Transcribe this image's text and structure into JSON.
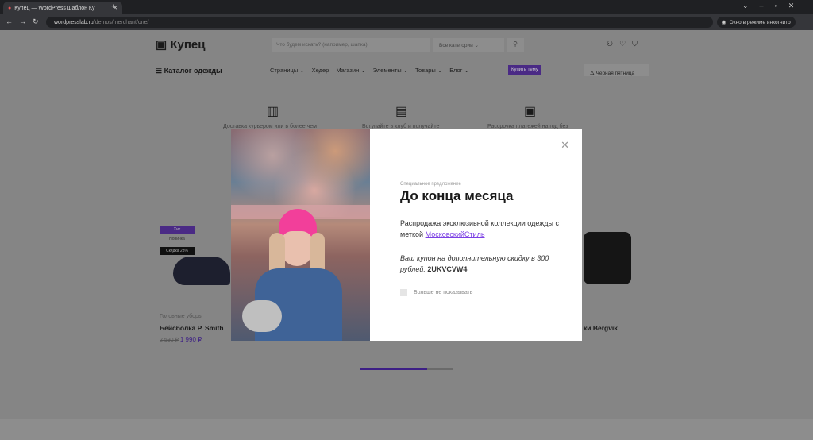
{
  "browser": {
    "tab_title": "Купец — WordPress шаблон Ку",
    "url_host": "wordpresslab.ru",
    "url_path": "/demos/merchant/one/",
    "profile": "Окно в режиме инкогнито"
  },
  "header": {
    "logo": "Купец",
    "search_placeholder": "Что будем искать? (например, шапка)",
    "category": "Все категории"
  },
  "nav": {
    "catalog": "Каталог одежды",
    "items": [
      "Страницы",
      "Хедер",
      "Магазин",
      "Элементы",
      "Товары",
      "Блог"
    ],
    "buy": "Купить тему",
    "promo": "Черная пятница"
  },
  "features": [
    "Доставка курьером или в более чем",
    "Вступайте в клуб и получайте",
    "Рассрочка платежей на год без"
  ],
  "product": {
    "badges": [
      "Хит",
      "Новинка",
      "Скидка 23%"
    ],
    "category": "Головные уборы",
    "name": "Бейсболка P. Smith",
    "old_price": "2 590 ₽",
    "price": "1 990 ₽",
    "right_name": "ки Bergvik"
  },
  "modal": {
    "eyebrow": "Специальное предложение",
    "title": "До конца месяца",
    "text1": "Распродажа эксклюзивной коллекции одежды с меткой ",
    "link": "МосковскийСтиль",
    "coupon_text": "Ваш купон на дополнительную скидку в 300 рублей: ",
    "coupon": "2UKVCVW4",
    "checkbox": "Больше не показывать"
  },
  "colors": {
    "accent": "#7b3fe4"
  }
}
